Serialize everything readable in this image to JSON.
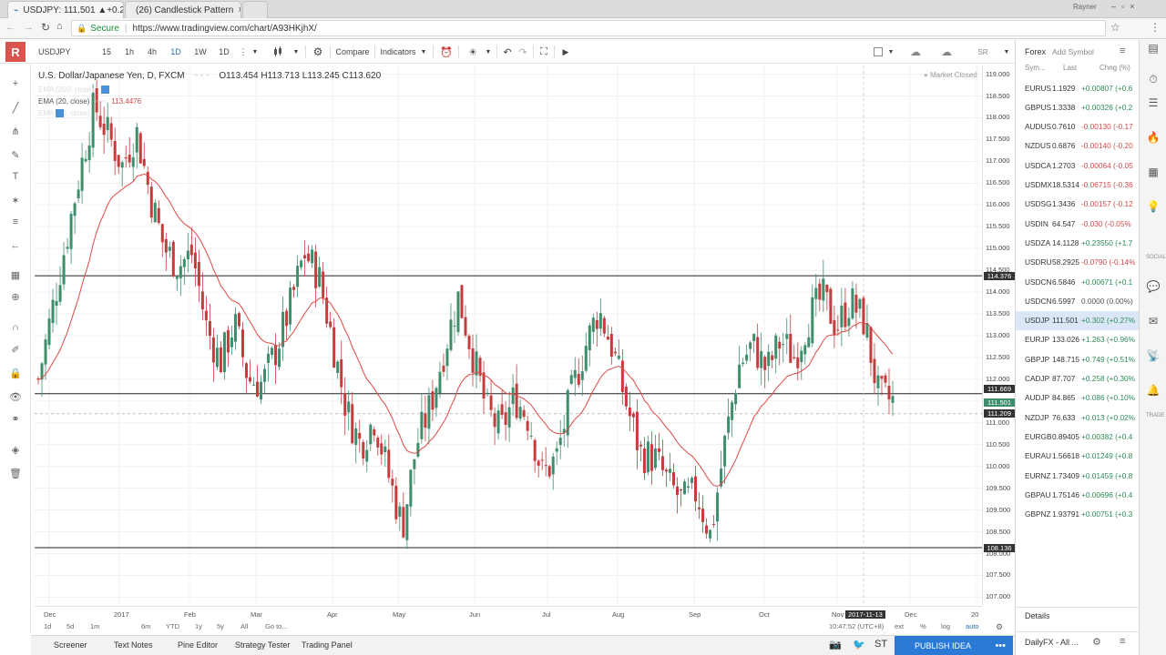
{
  "browser": {
    "tabs": [
      {
        "title": "USDJPY: 111.501 ▲+0.2"
      },
      {
        "title": "(26) Candlestick Pattern"
      }
    ],
    "user": "Rayner",
    "secure_label": "Secure",
    "url": "https://www.tradingview.com/chart/A93HKjhX/"
  },
  "toolbar": {
    "symbol": "USDJPY",
    "intervals": [
      "15",
      "1h",
      "4h",
      "1D",
      "1W",
      "1D"
    ],
    "compare_label": "Compare",
    "indicators_label": "Indicators",
    "profile_initials": "SR"
  },
  "legend": {
    "title": "U.S. Dollar/Japanese Yen, D, FXCM",
    "ohlc": "O113.454  H113.713  L113.245  C113.620",
    "ema200": "EMA (200, close)",
    "ema20": "EMA (20, close)",
    "ema20_value": "113.4476",
    "ema50": "EMA (50, close)",
    "market_status": "Market Closed"
  },
  "chart_data": {
    "type": "candlestick",
    "price_ticks": [
      119.0,
      118.5,
      118.0,
      117.5,
      117.0,
      116.5,
      116.0,
      115.5,
      115.0,
      114.5,
      114.0,
      113.5,
      113.0,
      112.5,
      112.0,
      111.5,
      111.0,
      110.5,
      110.0,
      109.5,
      109.0,
      108.5,
      108.0,
      107.5,
      107.0
    ],
    "price_labels": [
      {
        "value": "114.376",
        "style": "dark"
      },
      {
        "value": "111.669",
        "style": "dark"
      },
      {
        "value": "111.501",
        "style": "green"
      },
      {
        "value": "111.209",
        "style": "dark"
      },
      {
        "value": "108.136",
        "style": "dark"
      }
    ],
    "horizontal_lines": [
      114.376,
      111.669,
      108.136
    ],
    "time_labels": [
      "Dec",
      "2017",
      "Feb",
      "Mar",
      "Apr",
      "May",
      "Jun",
      "Jul",
      "Aug",
      "Sep",
      "Oct",
      "Nov",
      "2017-11-13",
      "Dec",
      "20"
    ],
    "ylim": [
      106.8,
      119.2
    ],
    "ema_color": "#e04848",
    "up_color": "#3d8f6c",
    "down_color": "#c63b3b",
    "closes": [
      112.0,
      113.6,
      115.2,
      116.8,
      118.3,
      117.6,
      116.9,
      117.7,
      116.2,
      115.0,
      114.6,
      114.9,
      113.2,
      112.4,
      113.3,
      112.0,
      111.9,
      112.7,
      113.7,
      114.9,
      114.4,
      112.9,
      111.3,
      110.5,
      111.1,
      109.8,
      108.6,
      110.5,
      111.4,
      112.7,
      113.9,
      112.6,
      111.3,
      110.8,
      111.6,
      111.1,
      109.8,
      110.2,
      111.6,
      112.7,
      113.6,
      112.7,
      111.4,
      110.3,
      110.2,
      109.6,
      109.2,
      109.4,
      108.4,
      110.5,
      112.3,
      112.8,
      112.2,
      112.9,
      112.5,
      113.4,
      113.9,
      113.2,
      113.8,
      113.3,
      111.6,
      111.5
    ],
    "crosshair_time": "10:47:52 (UTC+8)"
  },
  "range_bar": {
    "ranges": [
      "1d",
      "5d",
      "1m",
      "6m",
      "YTD",
      "1y",
      "5y",
      "All",
      "Go to..."
    ],
    "options": [
      "ext",
      "%",
      "log",
      "auto"
    ]
  },
  "bottom_bar": {
    "tabs": [
      "Screener",
      "Text Notes",
      "Pine Editor",
      "Strategy Tester",
      "Trading Panel"
    ],
    "publish_label": "PUBLISH IDEA"
  },
  "watchlist": {
    "title": "Forex",
    "add_symbol": "Add Symbol",
    "columns": [
      "Sym...",
      "Last",
      "Chng (%)"
    ],
    "rows": [
      {
        "sym": "EURUS",
        "last": "1.1929",
        "chg": "+0.00807 (+0.6",
        "dir": "pos"
      },
      {
        "sym": "GBPUS",
        "last": "1.3338",
        "chg": "+0.00326 (+0.2",
        "dir": "pos"
      },
      {
        "sym": "AUDUS",
        "last": "0.7610",
        "chg": "-0.00130 (-0.17",
        "dir": "neg"
      },
      {
        "sym": "NZDUS",
        "last": "0.6876",
        "chg": "-0.00140 (-0.20",
        "dir": "neg"
      },
      {
        "sym": "USDCA",
        "last": "1.2703",
        "chg": "-0.00064 (-0.05",
        "dir": "neg"
      },
      {
        "sym": "USDMX",
        "last": "18.5314",
        "chg": "-0.06715 (-0.36",
        "dir": "neg"
      },
      {
        "sym": "USDSG",
        "last": "1.3436",
        "chg": "-0.00157 (-0.12",
        "dir": "neg"
      },
      {
        "sym": "USDIN",
        "last": "64.547",
        "chg": "-0.030 (-0.05%",
        "dir": "neg"
      },
      {
        "sym": "USDZA",
        "last": "14.1128",
        "chg": "+0.23550 (+1.7",
        "dir": "pos"
      },
      {
        "sym": "USDRU",
        "last": "58.2925",
        "chg": "-0.0790 (-0.14%",
        "dir": "neg"
      },
      {
        "sym": "USDCN",
        "last": "6.5846",
        "chg": "+0.00671 (+0.1",
        "dir": "pos"
      },
      {
        "sym": "USDCN",
        "last": "6.5997",
        "chg": "0.0000 (0.00%)",
        "dir": "zero"
      },
      {
        "sym": "USDJP",
        "last": "111.501",
        "chg": "+0.302 (+0.27%",
        "dir": "pos",
        "selected": true
      },
      {
        "sym": "EURJP",
        "last": "133.026",
        "chg": "+1.263 (+0.96%",
        "dir": "pos"
      },
      {
        "sym": "GBPJP",
        "last": "148.715",
        "chg": "+0.749 (+0.51%",
        "dir": "pos"
      },
      {
        "sym": "CADJP",
        "last": "87.707",
        "chg": "+0.258 (+0.30%",
        "dir": "pos"
      },
      {
        "sym": "AUDJP",
        "last": "84.865",
        "chg": "+0.086 (+0.10%",
        "dir": "pos"
      },
      {
        "sym": "NZDJP",
        "last": "76.633",
        "chg": "+0.013 (+0.02%",
        "dir": "pos"
      },
      {
        "sym": "EURGB",
        "last": "0.89405",
        "chg": "+0.00382 (+0.4",
        "dir": "pos"
      },
      {
        "sym": "EURAU",
        "last": "1.56618",
        "chg": "+0.01249 (+0.8",
        "dir": "pos"
      },
      {
        "sym": "EURNZ",
        "last": "1.73409",
        "chg": "+0.01459 (+0.8",
        "dir": "pos"
      },
      {
        "sym": "GBPAU",
        "last": "1.75146",
        "chg": "+0.00696 (+0.4",
        "dir": "pos"
      },
      {
        "sym": "GBPNZ",
        "last": "1.93791",
        "chg": "+0.00751 (+0.3",
        "dir": "pos"
      }
    ],
    "details_label": "Details",
    "footer_list": "DailyFX - All ..."
  },
  "right_strip": {
    "social_label": "SOCIAL",
    "trade_label": "TRADE"
  }
}
